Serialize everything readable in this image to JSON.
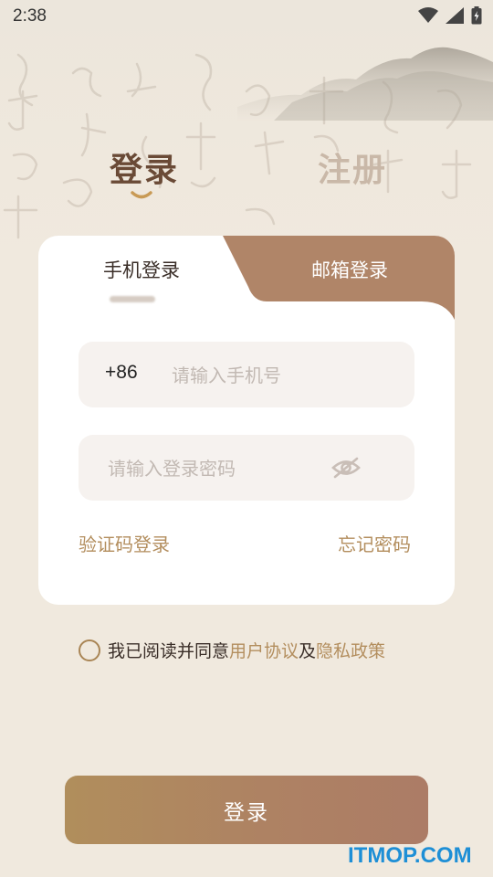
{
  "status_bar": {
    "time": "2:38"
  },
  "top_tabs": {
    "login": "登录",
    "register": "注册"
  },
  "card": {
    "tab_phone": "手机登录",
    "tab_email": "邮箱登录",
    "country_code": "+86",
    "phone_placeholder": "请输入手机号",
    "password_placeholder": "请输入登录密码",
    "sms_login_link": "验证码登录",
    "forgot_link": "忘记密码"
  },
  "agreement": {
    "prefix": "我已阅读并同意",
    "user_agreement": "用户协议",
    "conjunction": "及",
    "privacy_policy": "隐私政策"
  },
  "login_button": "登录",
  "watermark": "ITMOP.COM",
  "colors": {
    "accent": "#b38e5e",
    "tab_active_bg": "#b08568",
    "button_start": "#b08e5c",
    "button_end": "#ac7c66"
  },
  "icons": [
    "wifi-icon",
    "signal-icon",
    "battery-icon",
    "eye-off-icon"
  ]
}
